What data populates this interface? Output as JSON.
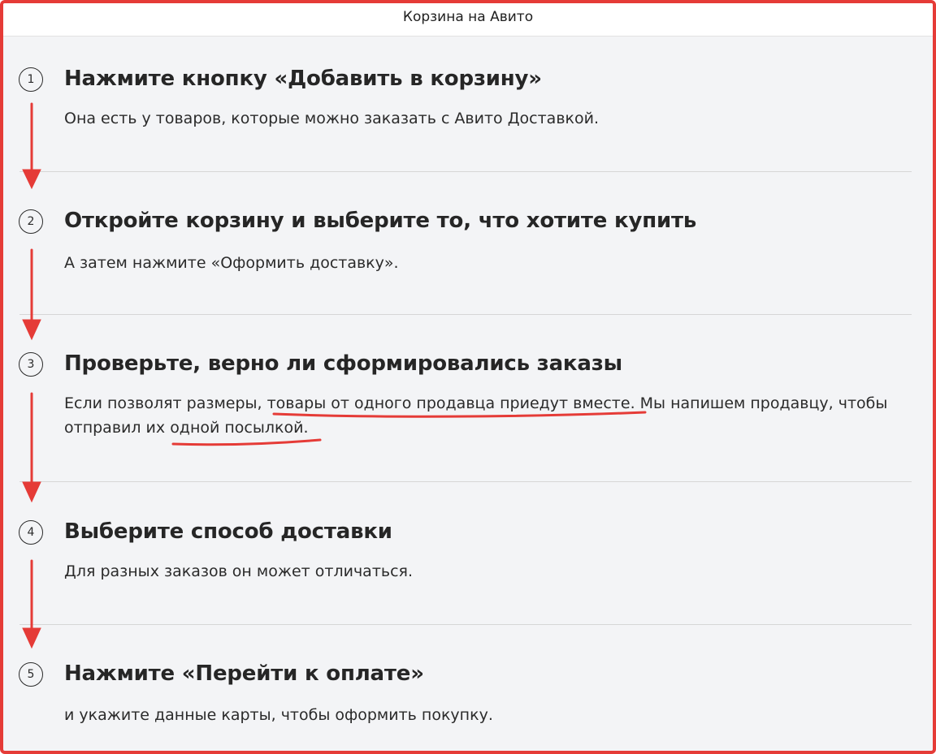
{
  "window": {
    "title": "Корзина на Авито"
  },
  "steps": [
    {
      "number": "1",
      "title": "Нажмите кнопку «Добавить в корзину»",
      "description": "Она есть у товаров, которые можно заказать с Авито Доставкой."
    },
    {
      "number": "2",
      "title": "Откройте корзину и выберите то, что хотите купить",
      "description": "А затем нажмите «Оформить доставку»."
    },
    {
      "number": "3",
      "title": "Проверьте, верно ли сформировались заказы",
      "description_parts": [
        "Если позволят размеры, ",
        "товары от одного продавца приедут вместе",
        ". Мы напишем продавцу, чтобы отправил их ",
        "одной посылкой",
        "."
      ]
    },
    {
      "number": "4",
      "title": "Выберите способ доставки",
      "description": "Для разных заказов он может отличаться."
    },
    {
      "number": "5",
      "title": "Нажмите «Перейти к оплате»",
      "description": "и укажите данные карты, чтобы оформить покупку."
    }
  ],
  "annotations": {
    "color": "#e53b37",
    "arrow_count": 4,
    "underlined_phrases": [
      "товары от одного продавца приедут вместе",
      "одной посылкой"
    ]
  }
}
